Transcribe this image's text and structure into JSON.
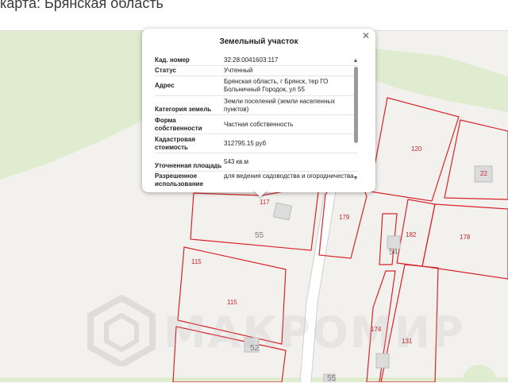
{
  "header": {
    "title": "карта: Брянская область"
  },
  "popup": {
    "title": "Земельный участок",
    "close_icon": "close-icon",
    "rows": [
      {
        "label": "Кад. номер",
        "value": "32:28:0041603:117"
      },
      {
        "label": "Статус",
        "value": "Учтенный"
      },
      {
        "label": "Адрес",
        "value": "Брянская область, г Брянск, тер ГО Больничный Городок, ул 55"
      },
      {
        "label": "Категория земель",
        "value": "Земли поселений (земли населенных пунктов)"
      },
      {
        "label": "Форма собственности",
        "value": "Частная собственность"
      },
      {
        "label": "Кадастровая стоимость",
        "value": "312795.15 руб"
      },
      {
        "label": "Уточненная площадь",
        "value": "543 кв.м"
      },
      {
        "label": "Разрешенное использование",
        "value": "для ведения садоводства и огородничества"
      }
    ]
  },
  "map": {
    "parcels": [
      "117",
      "179",
      "120",
      "22",
      "182",
      "178",
      "115",
      "174",
      "131"
    ],
    "houses": [
      "55",
      "52",
      "54",
      "55"
    ],
    "watermark": "МАКРОМИР",
    "colors": {
      "parcel_line": "#d9232a",
      "green": "#dfeccf",
      "road": "#ffffff",
      "background": "#f2f1ee"
    }
  }
}
